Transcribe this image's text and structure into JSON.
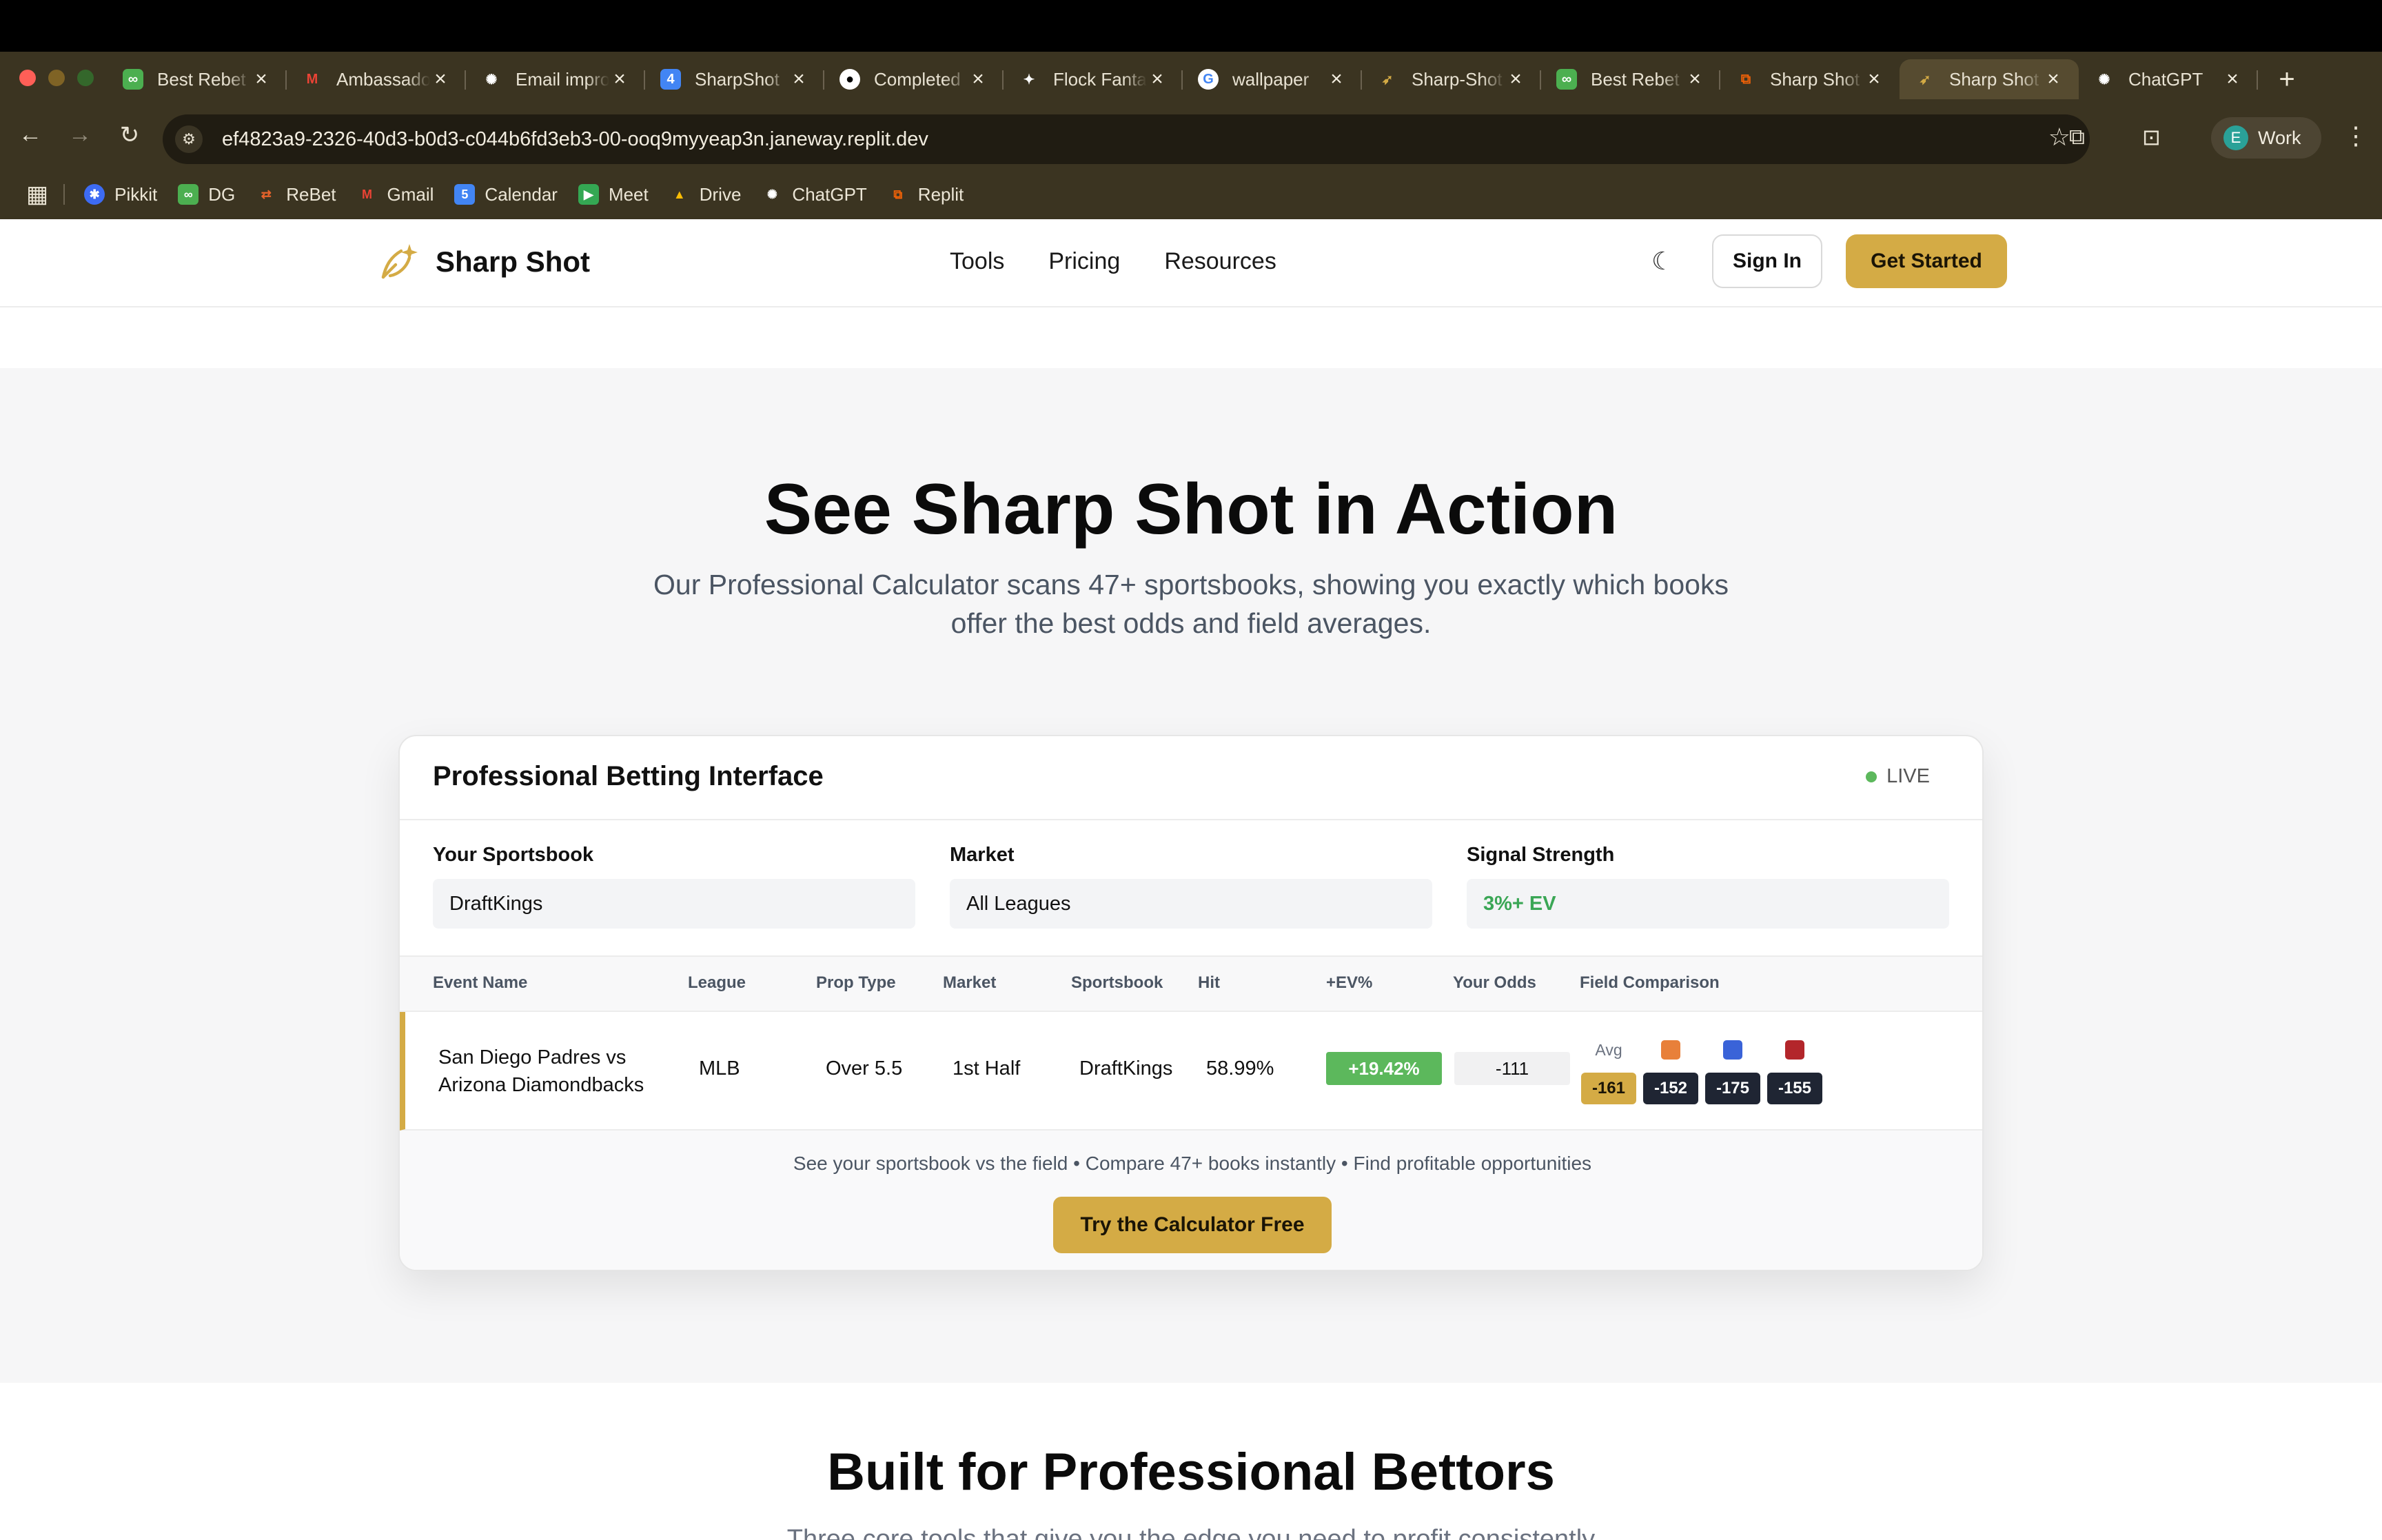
{
  "browser": {
    "tabs": [
      {
        "label": "Best Rebet",
        "icon": "rebet-link-icon",
        "color": "#4caf50"
      },
      {
        "label": "Ambassador",
        "icon": "gmail-icon",
        "color": "#ea4335"
      },
      {
        "label": "Email improv",
        "icon": "chatgpt-icon",
        "color": "#3b3421"
      },
      {
        "label": "SharpShot",
        "icon": "calendar-icon",
        "color": "#4285f4"
      },
      {
        "label": "Completed",
        "icon": "github-icon",
        "color": "#3b3421"
      },
      {
        "label": "Flock Fantasy",
        "icon": "flock-bird-icon",
        "color": "#3b3421"
      },
      {
        "label": "wallpaper",
        "icon": "google-icon",
        "color": "#ffffff"
      },
      {
        "label": "Sharp-Shot",
        "icon": "sharpshot-icon",
        "color": "#3b3421"
      },
      {
        "label": "Best Rebet",
        "icon": "rebet-link-icon",
        "color": "#4caf50"
      },
      {
        "label": "Sharp Shot",
        "icon": "replit-icon",
        "color": "#f26207"
      },
      {
        "label": "Sharp Shot",
        "icon": "sharpshot-icon",
        "color": "#3b3421"
      },
      {
        "label": "ChatGPT",
        "icon": "chatgpt-icon",
        "color": "#3b3421"
      }
    ],
    "active_tab_index": 10,
    "url": "ef4823a9-2326-40d3-b0d3-c044b6fd3eb3-00-ooq9myyeap3n.janeway.replit.dev",
    "profile_label": "Work",
    "profile_initial": "E",
    "bookmarks": [
      {
        "label": "Pikkit",
        "color": "#3d6bf3"
      },
      {
        "label": "DG",
        "color": "#4caf50"
      },
      {
        "label": "ReBet",
        "color": "#e8632b"
      },
      {
        "label": "Gmail",
        "color": "#ea4335"
      },
      {
        "label": "Calendar",
        "color": "#4285f4"
      },
      {
        "label": "Meet",
        "color": "#34a853"
      },
      {
        "label": "Drive",
        "color": "#fbbc04"
      },
      {
        "label": "ChatGPT",
        "color": "#3b3421"
      },
      {
        "label": "Replit",
        "color": "#f26207"
      }
    ]
  },
  "site": {
    "brand": "Sharp Shot",
    "nav": [
      "Tools",
      "Pricing",
      "Resources"
    ],
    "sign_in": "Sign In",
    "get_started": "Get Started",
    "accent_color": "#d4ab45"
  },
  "hero": {
    "title": "See Sharp Shot in Action",
    "subtitle": "Our Professional Calculator scans 47+ sportsbooks, showing you exactly which books offer the best odds and field averages."
  },
  "demo": {
    "title": "Professional Betting Interface",
    "status": "LIVE",
    "filters": [
      {
        "label": "Your Sportsbook",
        "value": "DraftKings"
      },
      {
        "label": "Market",
        "value": "All Leagues"
      },
      {
        "label": "Signal Strength",
        "value": "3%+ EV"
      }
    ],
    "columns": [
      "Event Name",
      "League",
      "Prop Type",
      "Market",
      "Sportsbook",
      "Hit",
      "+EV%",
      "Your Odds",
      "Field Comparison"
    ],
    "row": {
      "event_line1": "San Diego Padres vs",
      "event_line2": "Arizona Diamondbacks",
      "league": "MLB",
      "prop_type": "Over 5.5",
      "market": "1st Half",
      "sportsbook": "DraftKings",
      "hit": "58.99%",
      "ev": "+19.42%",
      "your_odds": "-111",
      "field": [
        {
          "label": "Avg",
          "value": "-161",
          "color": "#d4ab45"
        },
        {
          "label": "",
          "value": "-152",
          "color": "#e8803a"
        },
        {
          "label": "",
          "value": "-175",
          "color": "#3a63d8"
        },
        {
          "label": "",
          "value": "-155",
          "color": "#b3262b"
        }
      ]
    },
    "footer_text": "See your sportsbook vs the field • Compare 47+ books instantly • Find profitable opportunities",
    "cta": "Try the Calculator Free"
  },
  "section2": {
    "title": "Built for Professional Bettors",
    "subtitle": "Three core tools that give you the edge you need to profit consistently"
  }
}
